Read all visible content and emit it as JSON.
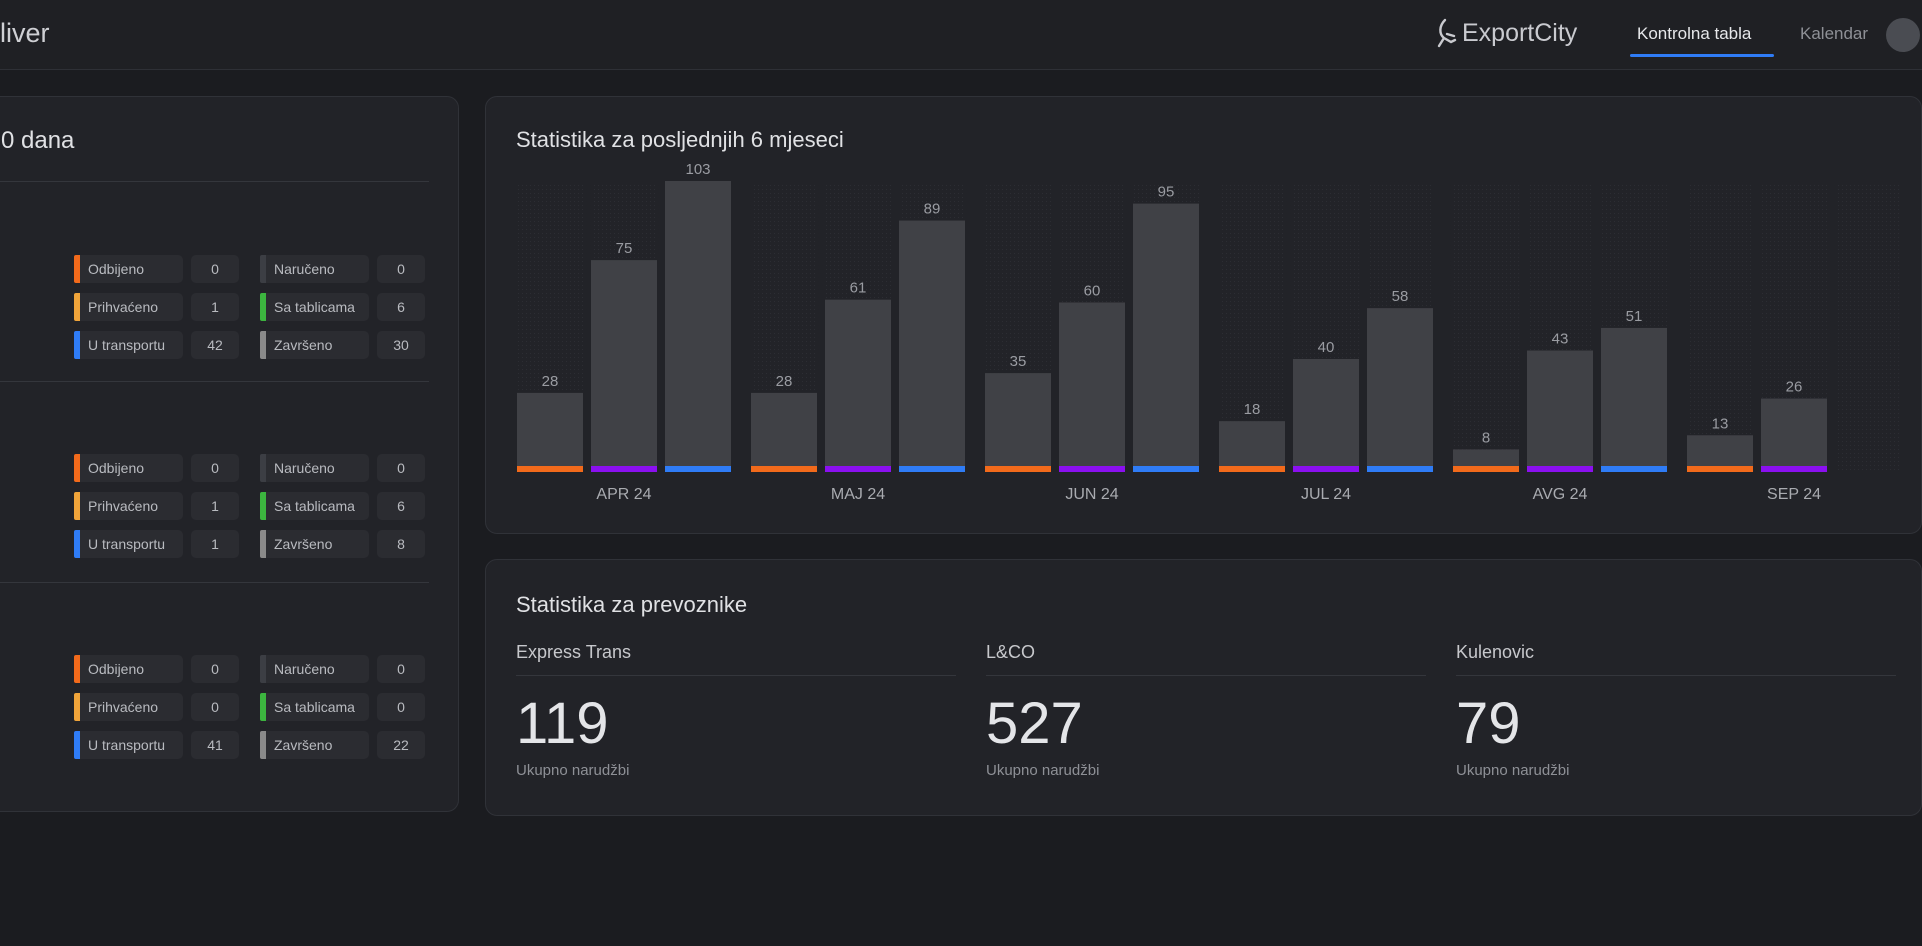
{
  "header": {
    "brand": "liver",
    "logo": "ExportCity",
    "nav": [
      {
        "label": "Kontrolna tabla",
        "active": true
      },
      {
        "label": "Kalendar",
        "active": false
      }
    ]
  },
  "left": {
    "title": "0 dana",
    "sections": [
      {
        "rows": [
          [
            "Odbijeno",
            "0",
            "Naručeno",
            "0"
          ],
          [
            "Prihvaćeno",
            "1",
            "Sa tablicama",
            "6"
          ],
          [
            "U transportu",
            "42",
            "Završeno",
            "30"
          ]
        ]
      },
      {
        "rows": [
          [
            "Odbijeno",
            "0",
            "Naručeno",
            "0"
          ],
          [
            "Prihvaćeno",
            "1",
            "Sa tablicama",
            "6"
          ],
          [
            "U transportu",
            "1",
            "Završeno",
            "8"
          ]
        ]
      },
      {
        "rows": [
          [
            "Odbijeno",
            "0",
            "Naručeno",
            "0"
          ],
          [
            "Prihvaćeno",
            "0",
            "Sa tablicama",
            "0"
          ],
          [
            "U transportu",
            "41",
            "Završeno",
            "22"
          ]
        ]
      }
    ]
  },
  "status_colors": {
    "Odbijeno": "#f26a1b",
    "Prihvaćeno": "#f0a43a",
    "U transportu": "#2f7cf6",
    "Naručeno": "#3c3e44",
    "Sa tablicama": "#3cb53f",
    "Završeno": "#8a8a8a"
  },
  "chart_data": {
    "type": "bar",
    "title": "Statistika za posljednjih 6 mjeseci",
    "categories": [
      "APR 24",
      "MAJ 24",
      "JUN 24",
      "JUL 24",
      "AVG 24",
      "SEP 24"
    ],
    "series": [
      {
        "values": [
          28,
          28,
          35,
          18,
          8,
          13
        ],
        "color": "#f26a1b"
      },
      {
        "values": [
          75,
          61,
          60,
          40,
          43,
          26
        ],
        "color": "#8b10f0"
      },
      {
        "values": [
          103,
          89,
          95,
          58,
          51,
          null
        ],
        "color": "#2f7cf6"
      }
    ],
    "ylim": [
      0,
      103
    ],
    "grid": false
  },
  "carriers": {
    "title": "Statistika za prevoznike",
    "items": [
      {
        "name": "Express Trans",
        "total": "119",
        "label": "Ukupno narudžbi"
      },
      {
        "name": "L&CO",
        "total": "527",
        "label": "Ukupno narudžbi"
      },
      {
        "name": "Kulenovic",
        "total": "79",
        "label": "Ukupno narudžbi"
      }
    ]
  }
}
